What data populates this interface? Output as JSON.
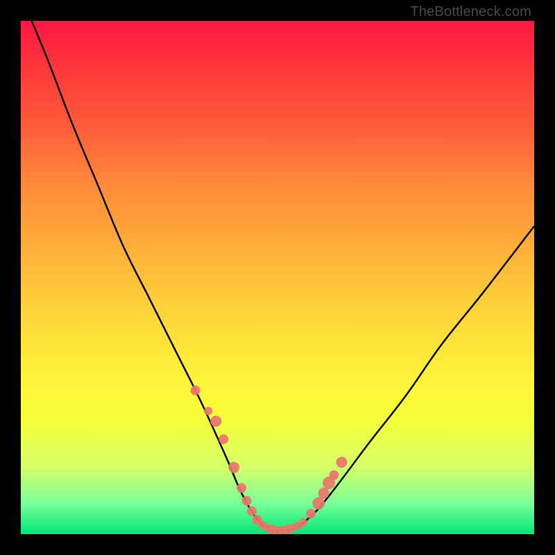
{
  "attribution": "TheBottleneck.com",
  "chart_data": {
    "type": "line",
    "title": "",
    "xlabel": "",
    "ylabel": "",
    "xlim": [
      0,
      100
    ],
    "ylim": [
      0,
      100
    ],
    "grid": false,
    "legend": false,
    "series": [
      {
        "name": "bottleneck-curve",
        "x": [
          0,
          5,
          10,
          15,
          20,
          25,
          30,
          35,
          40,
          43,
          46,
          49,
          50,
          51,
          53,
          55,
          58,
          62,
          68,
          75,
          82,
          90,
          100
        ],
        "values": [
          105,
          93,
          80,
          68,
          56,
          46,
          36,
          26,
          15,
          8,
          3,
          0.6,
          0.5,
          0.6,
          1,
          2.2,
          5,
          10,
          18,
          27,
          37,
          47,
          60
        ]
      }
    ],
    "markers": {
      "name": "highlight-points",
      "x": [
        34,
        36.5,
        38,
        39.5,
        41.5,
        43,
        44,
        45,
        46,
        47,
        48,
        49,
        50,
        51,
        52,
        53,
        54,
        55,
        56.5,
        58,
        59,
        60,
        61,
        62.5
      ],
      "y": [
        28,
        24,
        22,
        18.5,
        13,
        9,
        6.5,
        4.5,
        2.8,
        1.8,
        1.2,
        0.9,
        0.7,
        0.8,
        0.9,
        1.2,
        1.6,
        2.3,
        4,
        6,
        8,
        10,
        11.5,
        14
      ],
      "sizes": [
        7,
        6,
        8,
        7,
        8,
        7,
        7,
        7,
        7,
        6,
        6,
        7,
        6,
        6,
        7,
        6,
        6,
        6,
        7,
        9,
        8,
        9,
        7,
        8
      ]
    }
  }
}
